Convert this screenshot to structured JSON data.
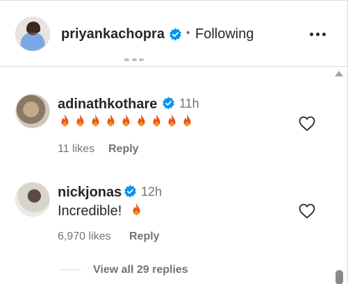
{
  "header": {
    "username": "priyankachopra",
    "separator": "•",
    "follow_status": "Following",
    "more_icon": "more-horizontal-icon"
  },
  "comments": [
    {
      "username": "adinathkothare",
      "verified": true,
      "time": "11h",
      "text_emoji": "fire",
      "emoji_count": 9,
      "likes": "11 likes",
      "reply_label": "Reply"
    },
    {
      "username": "nickjonas",
      "verified": true,
      "time": "12h",
      "text": "Incredible!",
      "text_emoji": "fire",
      "likes": "6,970 likes",
      "reply_label": "Reply"
    }
  ],
  "replies": {
    "view_all_label": "View all 29 replies"
  },
  "colors": {
    "verified_blue": "#0095f6",
    "fire_orange": "#f7931e",
    "fire_red": "#e8521f",
    "muted_text": "#737373"
  }
}
